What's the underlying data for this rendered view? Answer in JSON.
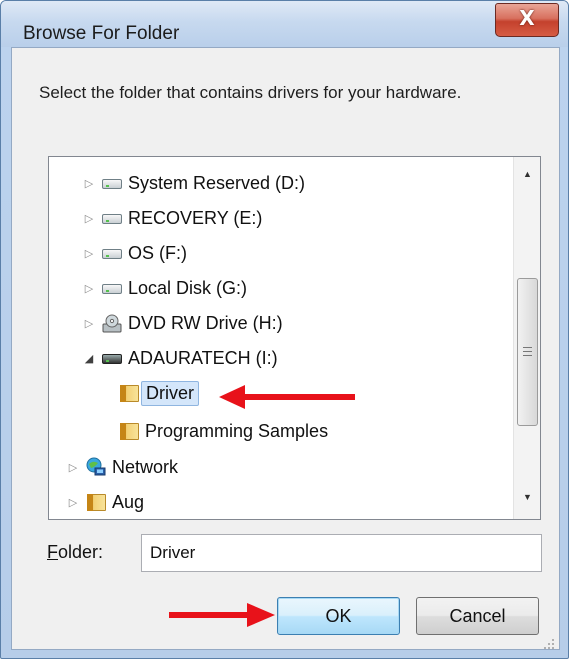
{
  "window": {
    "title": "Browse For Folder",
    "close_symbol": "X"
  },
  "description": "Select the folder that contains drivers for your hardware.",
  "tree": {
    "items": [
      {
        "label": "System Reserved (D:)",
        "icon": "hard-drive-icon",
        "expander": "collapsed"
      },
      {
        "label": "RECOVERY (E:)",
        "icon": "hard-drive-icon",
        "expander": "collapsed"
      },
      {
        "label": "OS (F:)",
        "icon": "hard-drive-icon",
        "expander": "collapsed"
      },
      {
        "label": "Local Disk (G:)",
        "icon": "hard-drive-icon",
        "expander": "collapsed"
      },
      {
        "label": "DVD RW Drive (H:)",
        "icon": "dvd-drive-icon",
        "expander": "collapsed"
      },
      {
        "label": "ADAURATECH (I:)",
        "icon": "usb-drive-icon",
        "expander": "expanded"
      },
      {
        "label": "Driver",
        "icon": "folder-icon",
        "selected": true
      },
      {
        "label": "Programming Samples",
        "icon": "folder-icon"
      },
      {
        "label": "Network",
        "icon": "network-icon",
        "expander": "collapsed"
      },
      {
        "label": "Aug",
        "icon": "folder-icon",
        "expander": "collapsed"
      }
    ]
  },
  "folder_field": {
    "label": "Folder:",
    "value": "Driver"
  },
  "buttons": {
    "ok": "OK",
    "cancel": "Cancel"
  },
  "annotation_color": "#e8121a"
}
